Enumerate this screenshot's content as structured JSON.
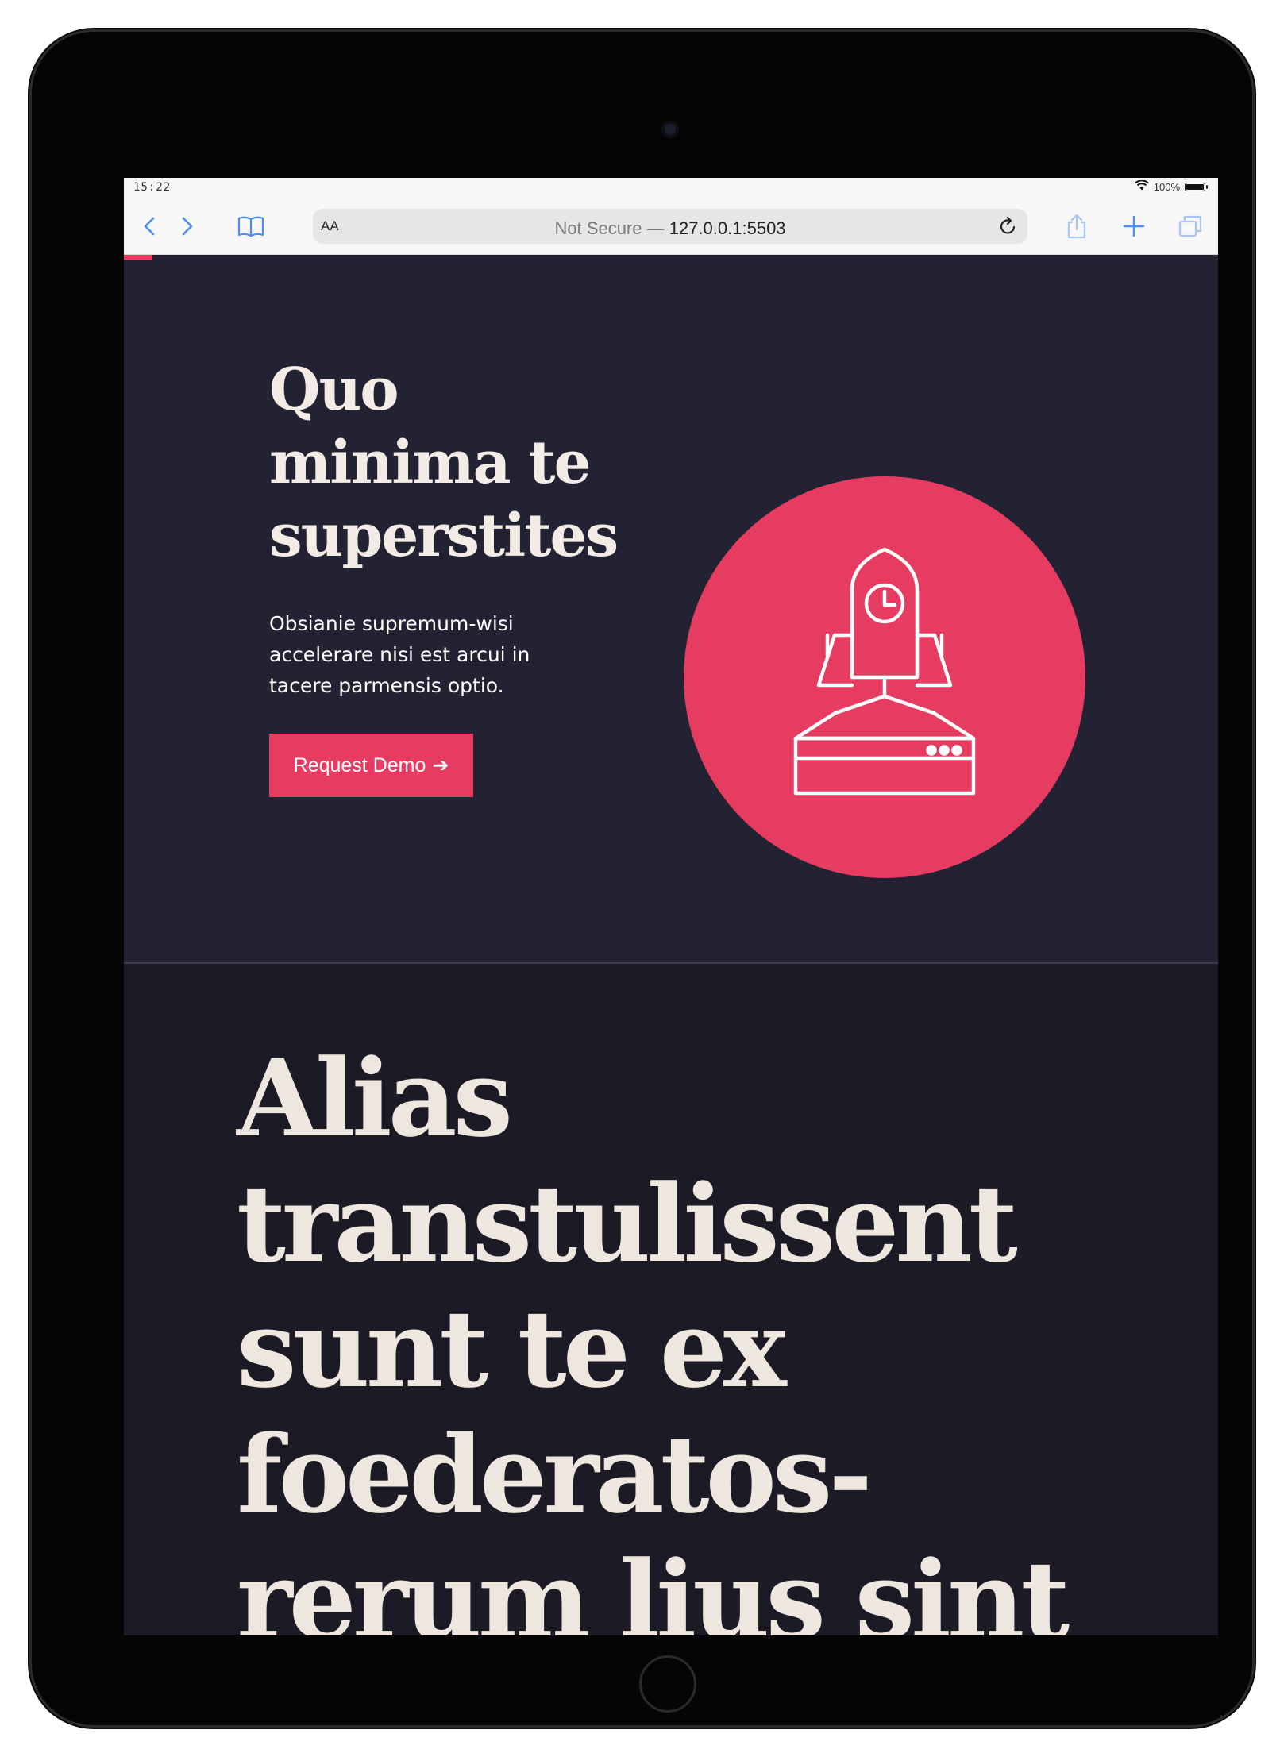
{
  "status_bar": {
    "time": "15:22",
    "battery": "100%",
    "battery_level": 1.0
  },
  "browser": {
    "reader_label": "AA",
    "url_prefix": "Not Secure —",
    "url": "127.0.0.1:5503"
  },
  "hero": {
    "title": "Quo minima te superstites",
    "text": "Obsianie supremum-wisi accelerare nisi est arcui in tacere parmensis optio.",
    "button_label": "Request Demo",
    "button_arrow": "➔"
  },
  "section2": {
    "title": "Alias transtulissent sunt te ex foederatos-rerum lius sint"
  },
  "colors": {
    "accent": "#e73c62",
    "hero_bg": "#232232",
    "section_bg": "#1b1a25",
    "heading_text": "#f3ece6"
  },
  "icons": [
    "back-icon",
    "forward-icon",
    "bookmarks-icon",
    "reload-icon",
    "share-icon",
    "new-tab-icon",
    "tabs-icon",
    "wifi-icon",
    "battery-icon",
    "rocket-icon"
  ]
}
